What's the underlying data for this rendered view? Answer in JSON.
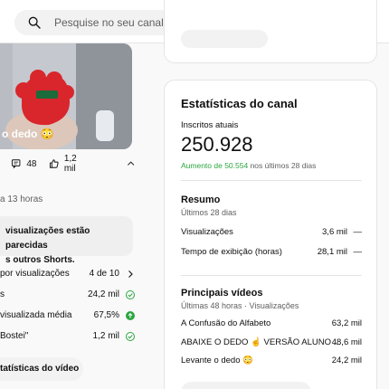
{
  "search": {
    "placeholder": "Pesquise no seu canal"
  },
  "video_card": {
    "title": "o dedo 😳",
    "comments": "48",
    "likes": "1,2 mil",
    "posted": "a 13 horas"
  },
  "insight": {
    "line1": "visualizações estão parecidas",
    "line2": "s outros Shorts."
  },
  "metrics": [
    {
      "label": "por visualizações",
      "value": "4 de 10",
      "icon": "chevron-right-icon"
    },
    {
      "label": "s",
      "value": "24,2 mil",
      "icon": "check-circle-icon"
    },
    {
      "label": "visualizada média",
      "value": "67,5%",
      "icon": "up-arrow-circle-icon"
    },
    {
      "label": "Bostei\"",
      "value": "1,2 mil",
      "icon": "check-circle-icon"
    }
  ],
  "left_pill": "tatísticas do vídeo",
  "channel": {
    "title": "Estatísticas do canal",
    "subs_label": "Inscritos atuais",
    "subs_value": "250.928",
    "growth_highlight": "Aumento de 50.554",
    "growth_rest": "nos últimos 28 dias",
    "summary": {
      "title": "Resumo",
      "period": "Últimos 28 dias",
      "rows": [
        {
          "label": "Visualizações",
          "value": "3,6 mil",
          "trend": "—"
        },
        {
          "label": "Tempo de exibição (horas)",
          "value": "28,1 mil",
          "trend": "—"
        }
      ]
    },
    "top_videos": {
      "title": "Principais vídeos",
      "period": "Últimas 48 horas · Visualizações",
      "rows": [
        {
          "label": "A Confusão do Alfabeto",
          "value": "63,2 mil"
        },
        {
          "label": "ABAIXE O DEDO ☝️ VERSÃO ALUNO ...",
          "value": "48,6 mil"
        },
        {
          "label": "Levante o dedo 😳",
          "value": "24,2 mil"
        }
      ]
    }
  },
  "colors": {
    "positive": "#2ba640",
    "accent": "#0f0f0f",
    "muted": "#606060"
  }
}
